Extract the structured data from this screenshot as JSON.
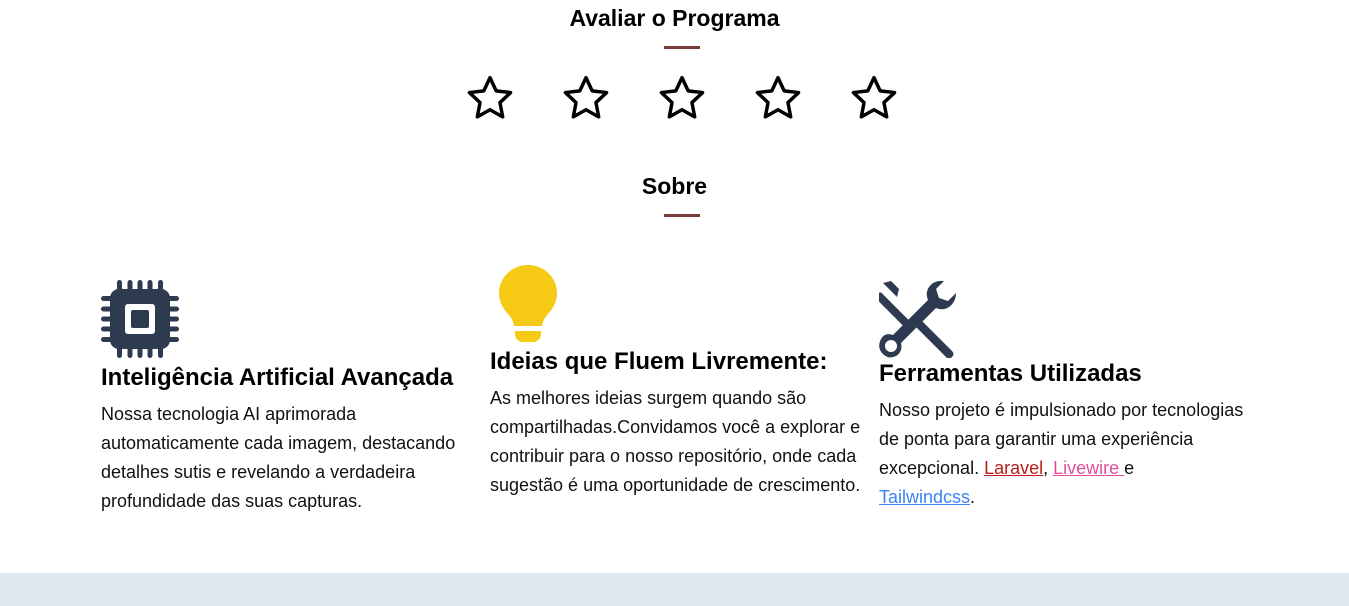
{
  "rating": {
    "title": "Avaliar o Programa",
    "stars_total": 5,
    "stars_selected": 0
  },
  "about": {
    "title": "Sobre"
  },
  "features": [
    {
      "icon": "cpu-chip-icon",
      "title": "Inteligência Artificial Avançada",
      "text": "Nossa tecnologia AI aprimorada automaticamente cada imagem, destacando detalhes sutis e revelando a verdadeira profundidade das suas capturas."
    },
    {
      "icon": "lightbulb-icon",
      "title": "Ideias que Fluem Livremente:",
      "text": "As melhores ideias surgem quando são compartilhadas.Convidamos você a explorar e contribuir para o nosso repositório, onde cada sugestão é uma oportunidade de crescimento."
    },
    {
      "icon": "tools-icon",
      "title": "Ferramentas Utilizadas",
      "text_before": "Nosso projeto é impulsionado por tecnologias de ponta para garantir uma experiência excepcional. ",
      "link_laravel": "Laravel",
      "sep1": ", ",
      "link_livewire": "Livewire ",
      "sep2": "e",
      "link_tailwind": "Tailwindcss",
      "end": "."
    }
  ],
  "colors": {
    "accent_underline": "#7a3b3b",
    "cpu_icon": "#2d3a4f",
    "bulb_icon": "#f6c915",
    "tools_icon": "#2d3a4f",
    "laravel_link": "#b91c1c",
    "livewire_link": "#e0509a",
    "tailwind_link": "#3b82f6",
    "footer_band": "#e0e7f0"
  }
}
